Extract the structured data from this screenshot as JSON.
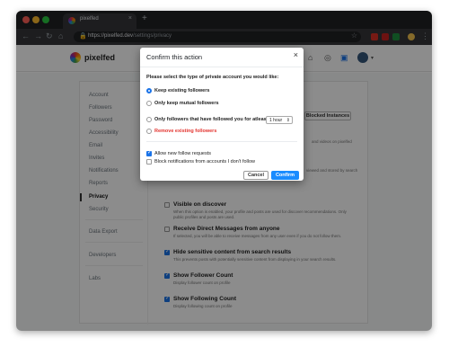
{
  "browser": {
    "tab_title": "pixelfed",
    "tab_close": "×",
    "new_tab": "+",
    "url_host": "https://pixelfed.dev",
    "url_path": "/settings/privacy",
    "colors": {
      "close": "#ff5f57",
      "minimize": "#febc2e",
      "maximize": "#28c840"
    }
  },
  "site": {
    "logo_text": "pixelfed",
    "search_placeholder": "Search"
  },
  "sidebar": {
    "items": [
      {
        "label": "Account"
      },
      {
        "label": "Followers"
      },
      {
        "label": "Password"
      },
      {
        "label": "Accessibility"
      },
      {
        "label": "Email"
      },
      {
        "label": "Invites"
      },
      {
        "label": "Notifications"
      },
      {
        "label": "Reports"
      },
      {
        "label": "Privacy"
      },
      {
        "label": "Security"
      },
      {
        "label": "Data Export"
      },
      {
        "label": "Developers"
      },
      {
        "label": "Labs"
      }
    ]
  },
  "privacy": {
    "blocked_instances_label": "Blocked Instances",
    "bg_fragment_1": "and videos on pixelfed",
    "bg_fragment_2": "viewed and stored by search",
    "settings": [
      {
        "title": "Visible on discover",
        "desc": "When this option is enabled, your profile and posts are used for discover recommendations. Only public profiles and posts are used.",
        "checked": false
      },
      {
        "title": "Receive Direct Messages from anyone",
        "desc": "If selected, you will be able to receive messages from any user even if you do not follow them.",
        "checked": false
      },
      {
        "title": "Hide sensitive content from search results",
        "desc": "This prevents posts with potentially sensitive content from displaying in your search results.",
        "checked": true
      },
      {
        "title": "Show Follower Count",
        "desc": "Display follower count on profile",
        "checked": true
      },
      {
        "title": "Show Following Count",
        "desc": "Display following count on profile",
        "checked": true
      }
    ]
  },
  "modal": {
    "title": "Confirm this action",
    "close_label": "×",
    "question": "Please select the type of private account you would like:",
    "options": [
      {
        "label": "Keep existing followers",
        "selected": true,
        "danger": false
      },
      {
        "label": "Only keep mutual followers",
        "selected": false,
        "danger": false
      },
      {
        "label": "Only followers that have followed you for atleast",
        "selected": false,
        "danger": false
      },
      {
        "label": "Remove existing followers",
        "selected": false,
        "danger": true
      }
    ],
    "duration_value": "1 hour",
    "checkboxes": [
      {
        "label": "Allow new follow requests",
        "checked": true
      },
      {
        "label": "Block notifications from accounts I don't follow",
        "checked": false
      }
    ],
    "cancel_label": "Cancel",
    "confirm_label": "Confirm",
    "accent_color": "#1a8cff",
    "danger_color": "#e3342f"
  }
}
